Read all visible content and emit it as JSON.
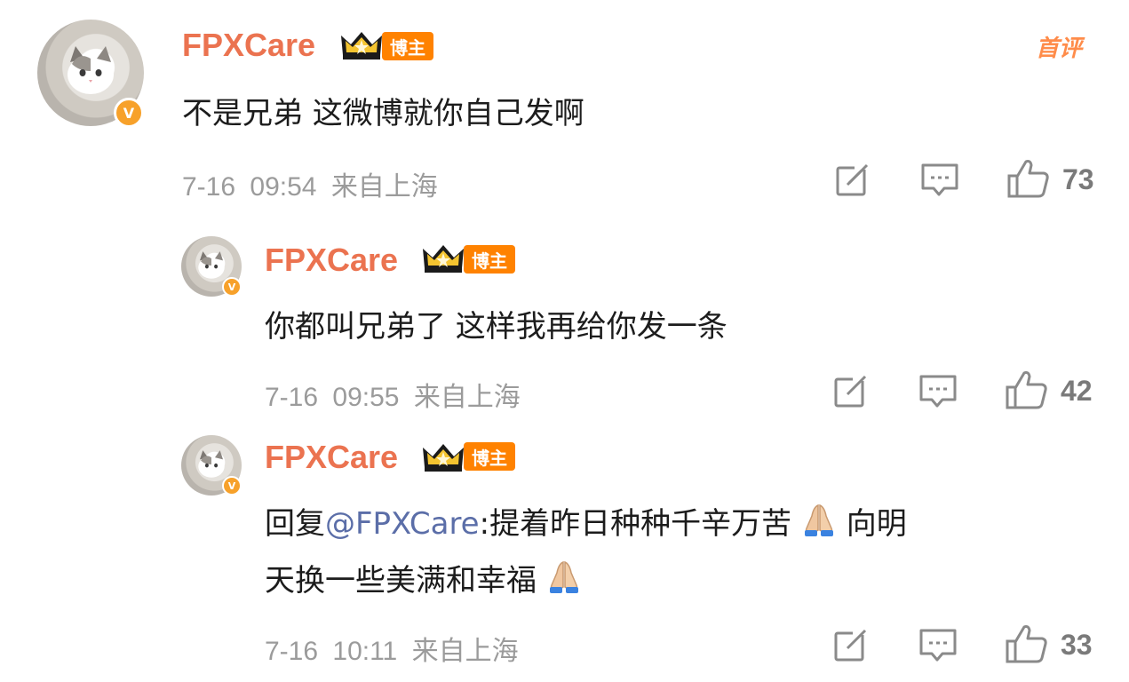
{
  "first_comment_label": "首评",
  "comments": [
    {
      "username": "FPXCare",
      "badge": "博主",
      "text": "不是兄弟 这微博就你自己发啊",
      "date": "7-16",
      "time": "09:54",
      "location": "来自上海",
      "likes": "73"
    },
    {
      "username": "FPXCare",
      "badge": "博主",
      "text": "你都叫兄弟了 这样我再给你发一条",
      "date": "7-16",
      "time": "09:55",
      "location": "来自上海",
      "likes": "42"
    },
    {
      "username": "FPXCare",
      "badge": "博主",
      "reply_prefix": "回复",
      "mention": "@FPXCare",
      "text_line1": ":提着昨日种种千辛万苦",
      "text_line1_end": "向明",
      "text_line2": "天换一些美满和幸福",
      "date": "7-16",
      "time": "10:11",
      "location": "来自上海",
      "likes": "33"
    }
  ],
  "icons": {
    "share": "share-icon",
    "comment": "comment-icon",
    "like": "thumbs-up-icon",
    "emoji": "folded-hands-emoji",
    "verified": "verified-v-icon",
    "crown": "crown-icon"
  },
  "colors": {
    "username": "#eb7350",
    "badge": "#ff8200",
    "mention": "#5b6ea8",
    "meta": "#9b9b9b",
    "verified": "#f7a12a"
  }
}
